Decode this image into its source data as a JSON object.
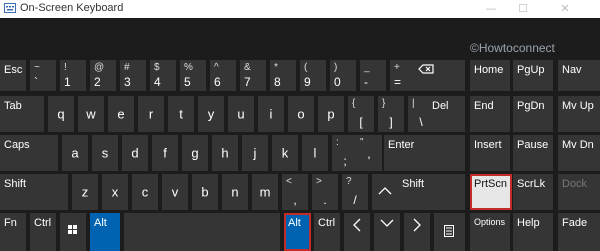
{
  "window": {
    "title": "On-Screen Keyboard",
    "minimize": "—",
    "maximize": "☐",
    "close": "✕"
  },
  "watermark": "©Howtoconnect",
  "row1": {
    "esc": "Esc",
    "k1": {
      "top": "~",
      "bottom": "`"
    },
    "k2": {
      "top": "!",
      "bottom": "1"
    },
    "k3": {
      "top": "@",
      "bottom": "2"
    },
    "k4": {
      "top": "#",
      "bottom": "3"
    },
    "k5": {
      "top": "$",
      "bottom": "4"
    },
    "k6": {
      "top": "%",
      "bottom": "5"
    },
    "k7": {
      "top": "^",
      "bottom": "6"
    },
    "k8": {
      "top": "&",
      "bottom": "7"
    },
    "k9": {
      "top": "*",
      "bottom": "8"
    },
    "k10": {
      "top": "(",
      "bottom": "9"
    },
    "k11": {
      "top": ")",
      "bottom": "0"
    },
    "k12": {
      "top": "_",
      "bottom": "-"
    },
    "k13": {
      "top": "+",
      "bottom": "="
    },
    "backspace_icon": "backspace-icon"
  },
  "row2": {
    "tab": "Tab",
    "letters": [
      "q",
      "w",
      "e",
      "r",
      "t",
      "y",
      "u",
      "i",
      "o",
      "p"
    ],
    "lbracket": {
      "top": "{",
      "bottom": "["
    },
    "rbracket": {
      "top": "}",
      "bottom": "]"
    },
    "backslash": {
      "top": "|",
      "bottom": "\\"
    },
    "del": "Del"
  },
  "row3": {
    "caps": "Caps",
    "letters": [
      "a",
      "s",
      "d",
      "f",
      "g",
      "h",
      "j",
      "k",
      "l"
    ],
    "semicolon": {
      "top": ":",
      "bottom": ";"
    },
    "quote": {
      "top": "\"",
      "bottom": "'"
    },
    "enter": "Enter"
  },
  "row4": {
    "shift_left": "Shift",
    "letters": [
      "z",
      "x",
      "c",
      "v",
      "b",
      "n",
      "m"
    ],
    "comma": {
      "top": "<",
      "bottom": ","
    },
    "period": {
      "top": ">",
      "bottom": "."
    },
    "slash": {
      "top": "?",
      "bottom": "/"
    },
    "shift_right": "Shift"
  },
  "row5": {
    "fn": "Fn",
    "ctrl_left": "Ctrl",
    "alt_left": "Alt",
    "alt_right": "Alt",
    "ctrl_right": "Ctrl"
  },
  "nav": {
    "home": "Home",
    "pgup": "PgUp",
    "nav": "Nav",
    "end": "End",
    "pgdn": "PgDn",
    "mvup": "Mv Up",
    "insert": "Insert",
    "pause": "Pause",
    "mvdn": "Mv Dn",
    "prtscn": "PrtScn",
    "scrlk": "ScrLk",
    "dock": "Dock",
    "options": "Options",
    "help": "Help",
    "fade": "Fade"
  },
  "colors": {
    "key": "#353535",
    "active": "#0063b1",
    "highlight": "#c42b2b",
    "background": "#1c1c1c"
  }
}
